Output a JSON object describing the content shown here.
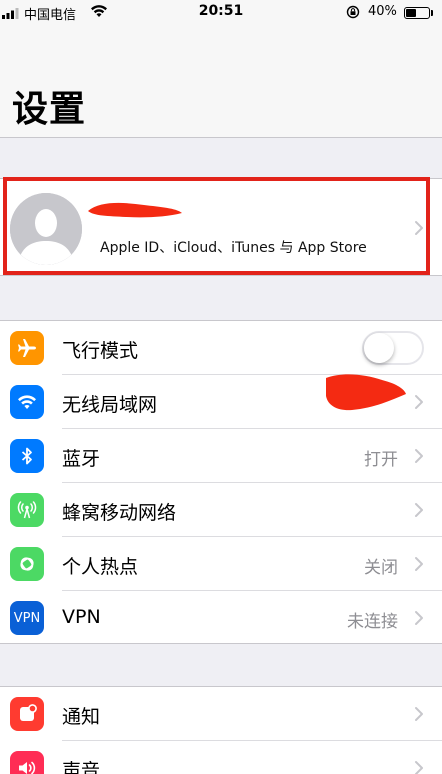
{
  "status_bar": {
    "carrier": "中国电信",
    "time": "20:51",
    "battery": "40%",
    "battery_level": 0.4
  },
  "nav": {
    "title": "设置"
  },
  "profile": {
    "subtitle": "Apple ID、iCloud、iTunes 与 App Store"
  },
  "settings": [
    {
      "label": "飞行模式",
      "icon": "airplane-icon",
      "color": "#ff9500",
      "toggle": false
    },
    {
      "label": "无线局域网",
      "icon": "wifi-icon",
      "color": "#007aff"
    },
    {
      "label": "蓝牙",
      "icon": "bluetooth-icon",
      "color": "#007aff",
      "value": "打开"
    },
    {
      "label": "蜂窝移动网络",
      "icon": "cellular-icon",
      "color": "#4cd964"
    },
    {
      "label": "个人热点",
      "icon": "hotspot-icon",
      "color": "#4cd964",
      "value": "关闭"
    },
    {
      "label": "VPN",
      "icon": "vpn-icon",
      "icon_text": "VPN",
      "color": "#0a60d6",
      "value": "未连接"
    }
  ],
  "settings2": [
    {
      "label": "通知",
      "icon": "notification-icon",
      "color": "#ff3b30"
    },
    {
      "label": "声音",
      "icon": "sound-icon",
      "color": "#ff2d55"
    }
  ],
  "colors": {
    "highlight": "#e2231a",
    "redaction": "#f42a12"
  }
}
